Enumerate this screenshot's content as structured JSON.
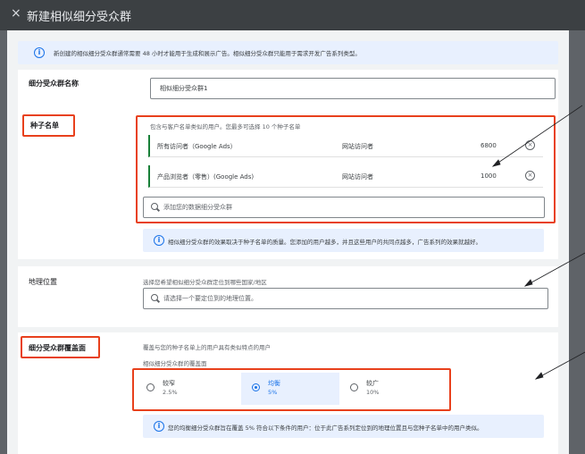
{
  "header": {
    "close_glyph": "×",
    "title": "新建相似细分受众群"
  },
  "banner": {
    "text": "新创建的相似细分受众群通常需要 48 小时才能用于生成和展示广告。相似细分受众群只能用于需求开发广告系列类型。"
  },
  "name_section": {
    "label": "细分受众群名称",
    "value": "相似细分受众群1"
  },
  "seed_section": {
    "label": "种子名单",
    "description": "包含与客户名单类似的用户。您最多可选择 10 个种子名单",
    "rows": [
      {
        "name": "所有访问者（Google Ads）",
        "type": "网站访问者",
        "count": "6800"
      },
      {
        "name": "产品浏览者（零售）(Google Ads)",
        "type": "网站访问者",
        "count": "1000"
      }
    ],
    "remove_glyph": "×",
    "search_placeholder": "添加您的数据细分受众群",
    "note": "相似细分受众群的效果取决于种子名单的质量。您添加的用户越多，并且这些用户的共同点越多，广告系列的效果就越好。"
  },
  "location_section": {
    "label": "地理位置",
    "description": "选择您希望相似细分受众群定位到哪些国家/地区",
    "search_placeholder": "请选择一个要定位到的地理位置。"
  },
  "coverage_section": {
    "label": "细分受众群覆盖面",
    "description": "覆盖与您的种子名单上的用户具有类似特点的用户",
    "sub_label": "相似细分受众群的覆盖面",
    "options": [
      {
        "label": "较窄",
        "percent": "2.5%",
        "selected": false
      },
      {
        "label": "均衡",
        "percent": "5%",
        "selected": true
      },
      {
        "label": "较广",
        "percent": "10%",
        "selected": false
      }
    ],
    "note": "您的均衡细分受众群旨在覆盖 5% 符合以下条件的用户：位于此广告系列定位到的地理位置且与您种子名单中的用户类似。"
  },
  "colors": {
    "annotation_red": "#e8401c",
    "accent_blue": "#1a73e8",
    "seed_row_bar": "#188038"
  }
}
